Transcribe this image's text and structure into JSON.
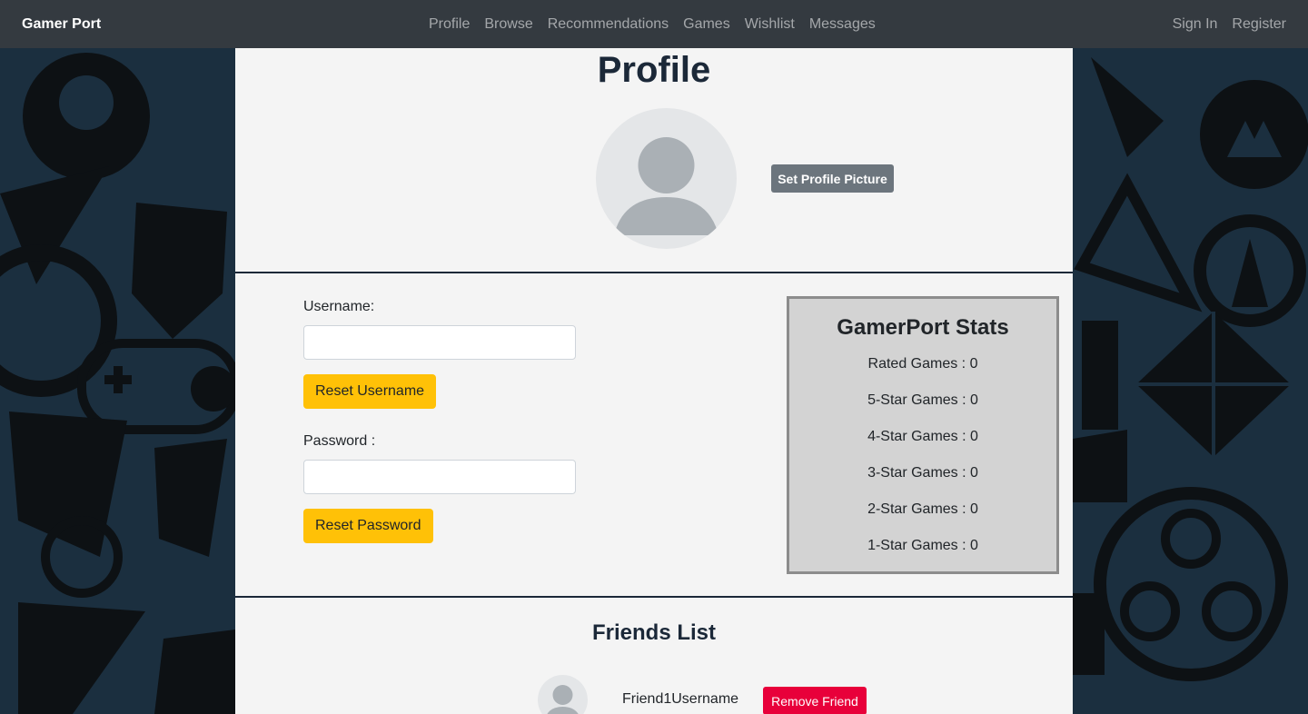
{
  "navbar": {
    "brand": "Gamer Port",
    "links": [
      "Profile",
      "Browse",
      "Recommendations",
      "Games",
      "Wishlist",
      "Messages"
    ],
    "auth": [
      "Sign In",
      "Register"
    ]
  },
  "profile": {
    "title": "Profile",
    "set_picture_label": "Set Profile Picture"
  },
  "account": {
    "username_label": "Username:",
    "username_value": "",
    "reset_username_label": "Reset Username",
    "password_label": "Password :",
    "password_value": "",
    "reset_password_label": "Reset Password"
  },
  "stats": {
    "title": "GamerPort Stats",
    "lines": [
      "Rated Games : 0",
      "5-Star Games : 0",
      "4-Star Games : 0",
      "3-Star Games : 0",
      "2-Star Games : 0",
      "1-Star Games : 0"
    ]
  },
  "friends": {
    "title": "Friends List",
    "items": [
      {
        "username": "Friend1Username",
        "remove_label": "Remove Friend"
      }
    ]
  },
  "colors": {
    "navbar": "#343a40",
    "background": "#1b2f3f",
    "panel": "#f4f4f4",
    "warning": "#ffc107",
    "secondary": "#6c757d",
    "danger": "#e8003a"
  }
}
